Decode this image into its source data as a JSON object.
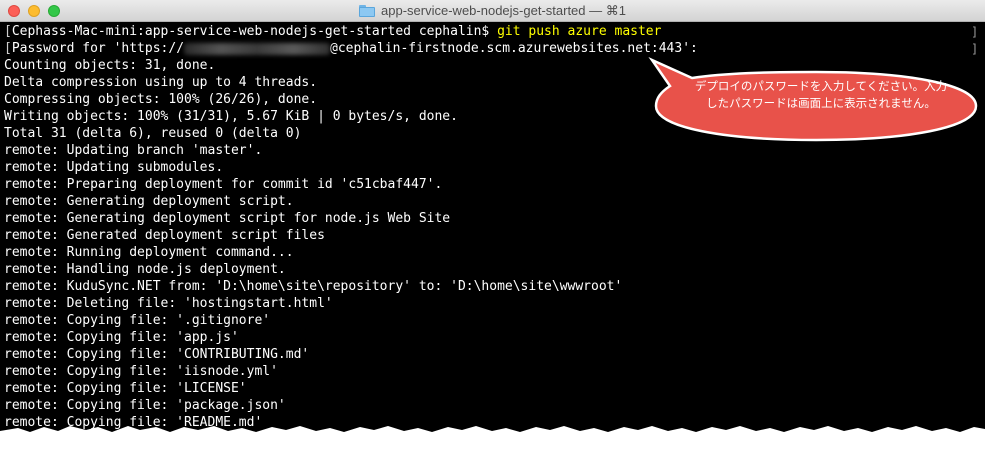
{
  "window": {
    "title": "app-service-web-nodejs-get-started — ⌘1",
    "folder_icon": "folder-icon"
  },
  "terminal": {
    "prompt_line": {
      "bracket": "[",
      "prompt": "Cephass-Mac-mini:app-service-web-nodejs-get-started cephalin$ ",
      "command": "git push azure master"
    },
    "password_line": {
      "bracket": "[",
      "prefix": "Password for 'https://",
      "suffix": "@cephalin-firstnode.scm.azurewebsites.net:443':"
    },
    "lines": [
      "Counting objects: 31, done.",
      "Delta compression using up to 4 threads.",
      "Compressing objects: 100% (26/26), done.",
      "Writing objects: 100% (31/31), 5.67 KiB | 0 bytes/s, done.",
      "Total 31 (delta 6), reused 0 (delta 0)",
      "remote: Updating branch 'master'.",
      "remote: Updating submodules.",
      "remote: Preparing deployment for commit id 'c51cbaf447'.",
      "remote: Generating deployment script.",
      "remote: Generating deployment script for node.js Web Site",
      "remote: Generated deployment script files",
      "remote: Running deployment command...",
      "remote: Handling node.js deployment.",
      "remote: KuduSync.NET from: 'D:\\home\\site\\repository' to: 'D:\\home\\site\\wwwroot'",
      "remote: Deleting file: 'hostingstart.html'",
      "remote: Copying file: '.gitignore'",
      "remote: Copying file: 'app.js'",
      "remote: Copying file: 'CONTRIBUTING.md'",
      "remote: Copying file: 'iisnode.yml'",
      "remote: Copying file: 'LICENSE'",
      "remote: Copying file: 'package.json'",
      "remote: Copying file: 'README.md'"
    ]
  },
  "scrollbar": {
    "marks": [
      "]",
      "]"
    ]
  },
  "callout": {
    "text": "デプロイのパスワードを入力してください。入力したパスワードは画面上に表示されません。",
    "fill_color": "#e8524a",
    "border_color": "#ffffff"
  }
}
